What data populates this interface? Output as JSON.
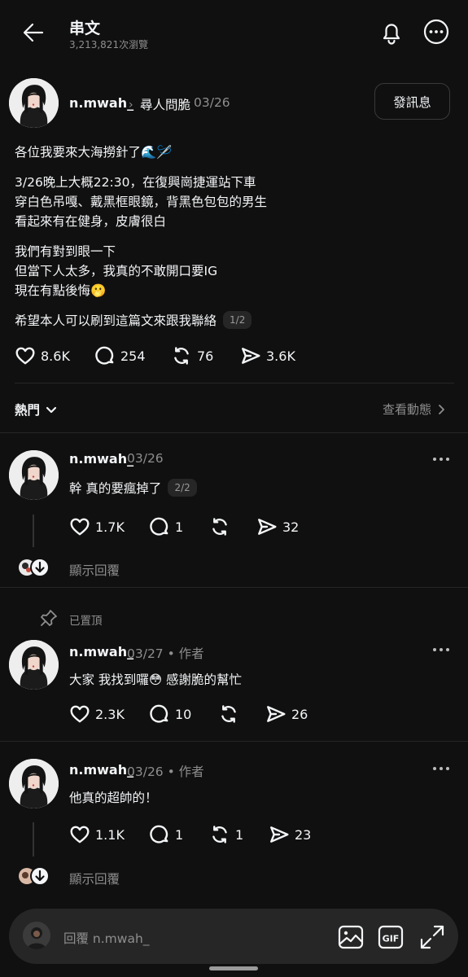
{
  "header": {
    "title": "串文",
    "views": "3,213,821次瀏覽"
  },
  "post": {
    "author": "n.mwah_",
    "community": "尋人問脆",
    "date": "03/26",
    "message_button": "發訊息",
    "lines": [
      "各位我要來大海撈針了🌊🪡",
      "3/26晚上大概22:30，在復興崗捷運站下車",
      "穿白色吊嘎、戴黑框眼鏡，背黑色包包的男生",
      "看起來有在健身，皮膚很白",
      "我們有對到眼一下",
      "但當下人太多，我真的不敢開口要IG",
      "現在有點後悔🫢",
      "希望本人可以刷到這篇文來跟我聯絡"
    ],
    "pager": "1/2",
    "likes": "8.6K",
    "comments": "254",
    "reposts": "76",
    "shares": "3.6K"
  },
  "sort": {
    "label": "熱門",
    "activity": "查看動態"
  },
  "replies": [
    {
      "author": "n.mwah_",
      "meta": "03/26",
      "text": "幹 真的要瘋掉了",
      "pager": "2/2",
      "likes": "1.7K",
      "comments": "1",
      "reposts": "",
      "shares": "32",
      "show_replies": "顯示回覆"
    },
    {
      "pinned_label": "已置頂",
      "author": "n.mwah_",
      "meta": "03/27 • 作者",
      "text": "大家 我找到囉😳 感謝脆的幫忙",
      "likes": "2.3K",
      "comments": "10",
      "reposts": "",
      "shares": "26"
    },
    {
      "author": "n.mwah_",
      "meta": "03/26 • 作者",
      "text": "他真的超帥的！",
      "likes": "1.1K",
      "comments": "1",
      "reposts": "1",
      "shares": "23",
      "show_replies": "顯示回覆"
    }
  ],
  "composer": {
    "placeholder": "回覆 n.mwah_"
  },
  "icons": {
    "back": "arrow-left-icon",
    "bell": "bell-icon",
    "more": "more-circle-icon",
    "like": "heart-icon",
    "comment": "comment-icon",
    "repost": "repost-icon",
    "share": "send-icon",
    "pin": "pin-icon",
    "image": "image-icon",
    "gif": "gif-icon",
    "expand": "expand-icon"
  },
  "colors": {
    "background": "#101010",
    "text": "#f3f5f7",
    "muted": "#8e8e8e",
    "composer": "#262626"
  }
}
